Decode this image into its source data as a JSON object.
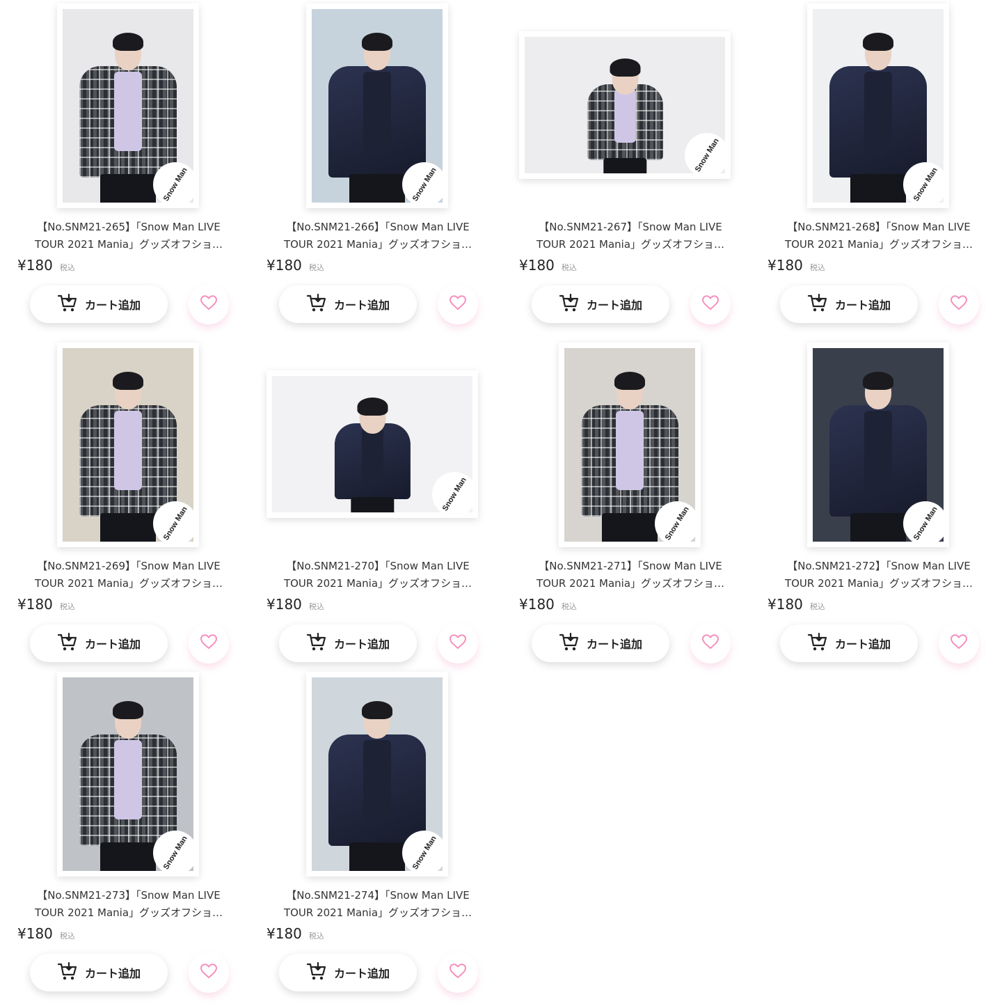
{
  "products": [
    {
      "title_line1": "【No.SNM21-265】「Snow Man LIVE",
      "title_line2": "TOUR 2021 Mania」グッズオフショ…",
      "price": "¥180",
      "tax_label": "税込",
      "cart_label": "カート追加",
      "photo_watermark": "Snow Man",
      "pose": "plaid",
      "orientation": "portrait",
      "background": "#e8e8ea"
    },
    {
      "title_line1": "【No.SNM21-266】「Snow Man LIVE",
      "title_line2": "TOUR 2021 Mania」グッズオフショ…",
      "price": "¥180",
      "tax_label": "税込",
      "cart_label": "カート追加",
      "photo_watermark": "Snow Man",
      "pose": "suit",
      "orientation": "portrait",
      "background": "#c6d3dd"
    },
    {
      "title_line1": "【No.SNM21-267】「Snow Man LIVE",
      "title_line2": "TOUR 2021 Mania」グッズオフショ…",
      "price": "¥180",
      "tax_label": "税込",
      "cart_label": "カート追加",
      "photo_watermark": "Snow Man",
      "pose": "plaid",
      "orientation": "landscape",
      "background": "#ededef"
    },
    {
      "title_line1": "【No.SNM21-268】「Snow Man LIVE",
      "title_line2": "TOUR 2021 Mania」グッズオフショ…",
      "price": "¥180",
      "tax_label": "税込",
      "cart_label": "カート追加",
      "photo_watermark": "Snow Man",
      "pose": "suit",
      "orientation": "portrait",
      "background": "#eef0f2"
    },
    {
      "title_line1": "【No.SNM21-269】「Snow Man LIVE",
      "title_line2": "TOUR 2021 Mania」グッズオフショ…",
      "price": "¥180",
      "tax_label": "税込",
      "cart_label": "カート追加",
      "photo_watermark": "Snow Man",
      "pose": "plaid",
      "orientation": "portrait",
      "background": "#d9d2c6"
    },
    {
      "title_line1": "【No.SNM21-270】「Snow Man LIVE",
      "title_line2": "TOUR 2021 Mania」グッズオフショ…",
      "price": "¥180",
      "tax_label": "税込",
      "cart_label": "カート追加",
      "photo_watermark": "Snow Man",
      "pose": "suit",
      "orientation": "landscape",
      "background": "#f2f2f4"
    },
    {
      "title_line1": "【No.SNM21-271】「Snow Man LIVE",
      "title_line2": "TOUR 2021 Mania」グッズオフショ…",
      "price": "¥180",
      "tax_label": "税込",
      "cart_label": "カート追加",
      "photo_watermark": "Snow Man",
      "pose": "plaid",
      "orientation": "portrait",
      "background": "#d7d3cf"
    },
    {
      "title_line1": "【No.SNM21-272】「Snow Man LIVE",
      "title_line2": "TOUR 2021 Mania」グッズオフショ…",
      "price": "¥180",
      "tax_label": "税込",
      "cart_label": "カート追加",
      "photo_watermark": "Snow Man",
      "pose": "suit",
      "orientation": "portrait",
      "background": "#3a3f4c"
    },
    {
      "title_line1": "【No.SNM21-273】「Snow Man LIVE",
      "title_line2": "TOUR 2021 Mania」グッズオフショ…",
      "price": "¥180",
      "tax_label": "税込",
      "cart_label": "カート追加",
      "photo_watermark": "Snow Man",
      "pose": "plaid",
      "orientation": "portrait",
      "background": "#bfc2c6"
    },
    {
      "title_line1": "【No.SNM21-274】「Snow Man LIVE",
      "title_line2": "TOUR 2021 Mania」グッズオフショ…",
      "price": "¥180",
      "tax_label": "税込",
      "cart_label": "カート追加",
      "photo_watermark": "Snow Man",
      "pose": "suit",
      "orientation": "portrait",
      "background": "#cfd6dc"
    }
  ],
  "icons": {
    "cart": "cart-add-icon",
    "favorite": "heart-outline-icon"
  },
  "colors": {
    "heart": "#f58fbd",
    "text": "#333333",
    "tax": "#999999",
    "button_bg": "#ffffff"
  }
}
